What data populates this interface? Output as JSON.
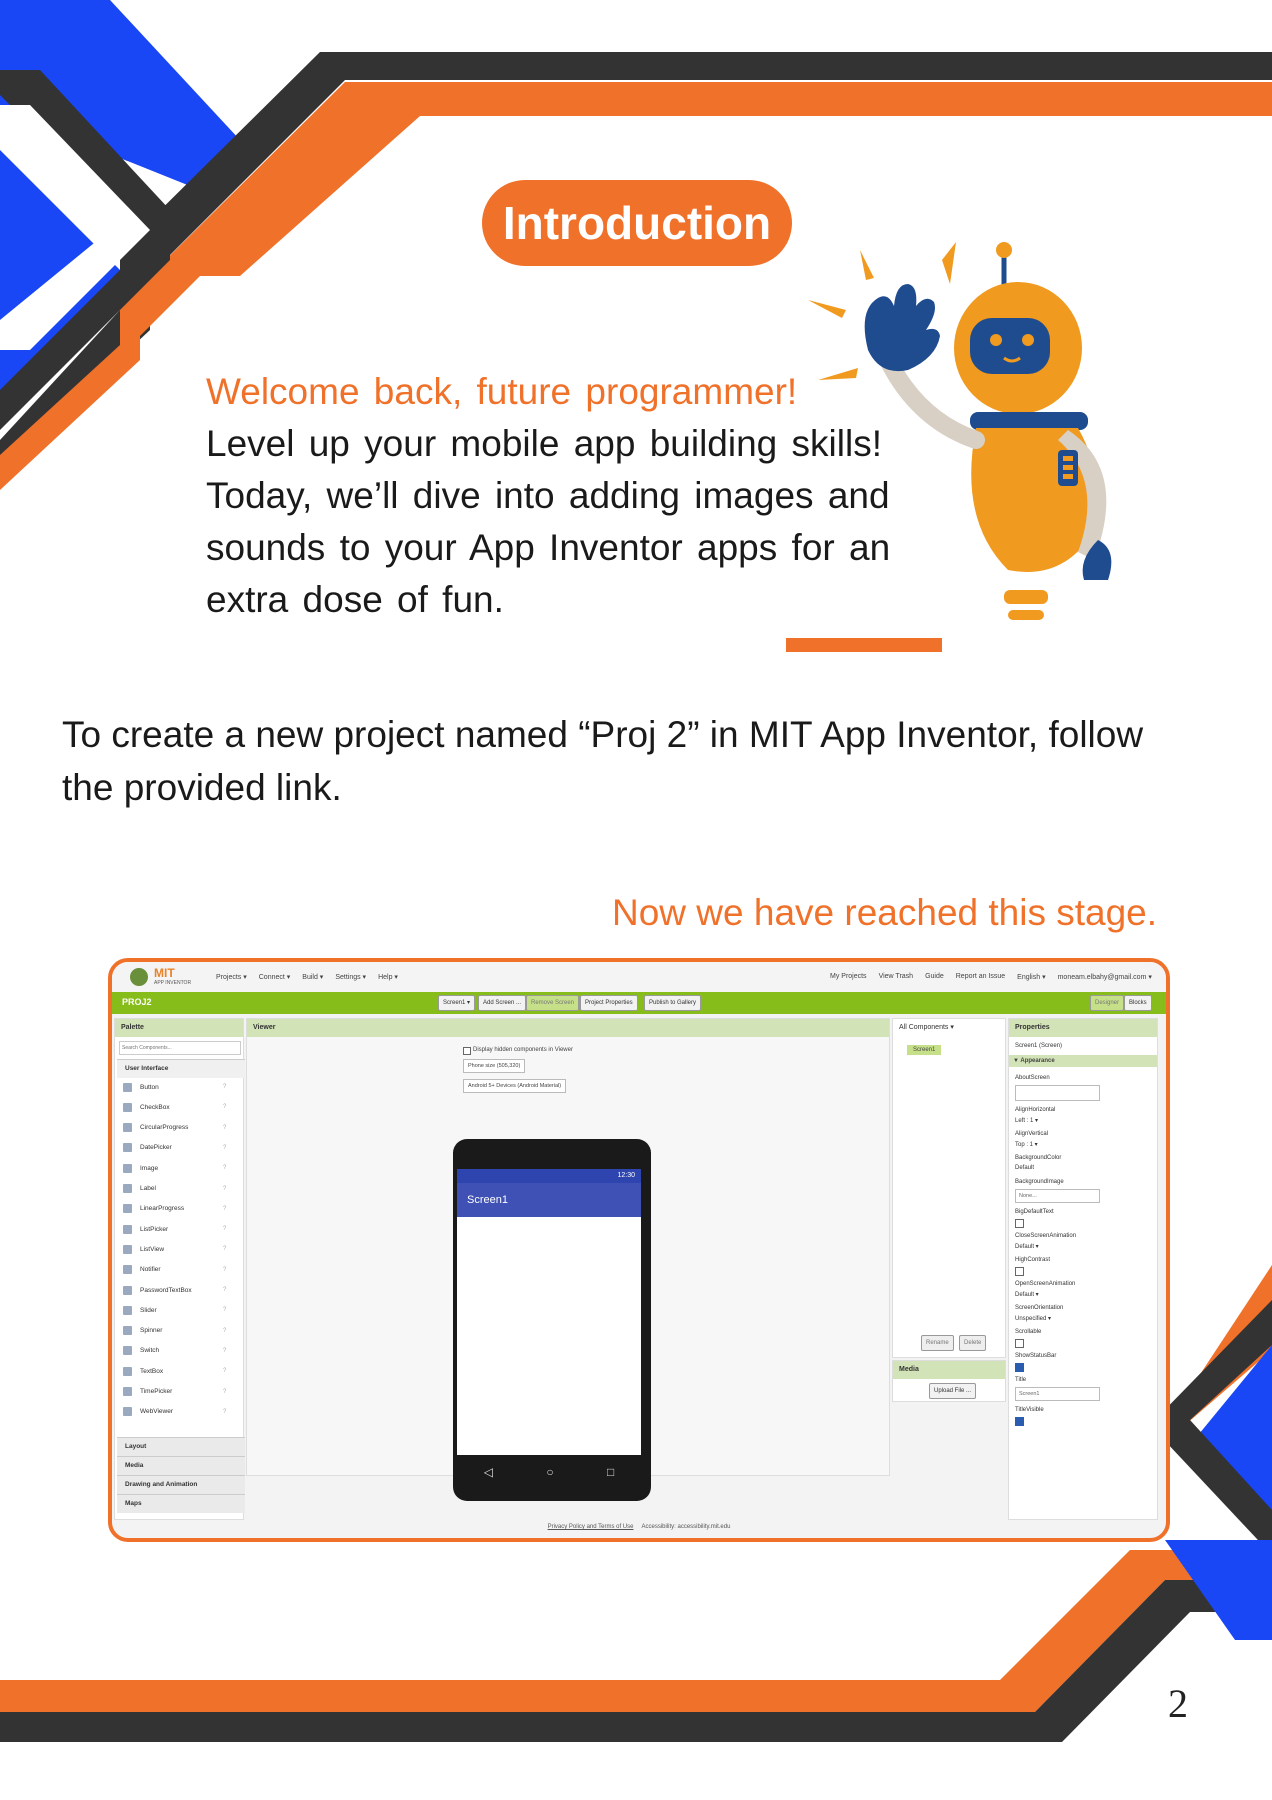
{
  "heading": "Introduction",
  "welcome": {
    "greeting": "Welcome back, future programmer!",
    "line2": "Level up your mobile app building skills!",
    "line3": "Today, we’ll dive into adding images and",
    "line4": "sounds to your App Inventor apps for an",
    "line5": "extra dose of fun."
  },
  "instruction": {
    "line1": "To create a new project named “Proj 2” in MIT App Inventor, follow",
    "line2": "the provided link."
  },
  "stage_note": "Now we have reached this stage.",
  "page_number": "2",
  "colors": {
    "accent": "#f0712a",
    "blue": "#1a47f5",
    "dark": "#333333",
    "app_green": "#86bd1a"
  },
  "app_inventor": {
    "logo": {
      "title": "MIT",
      "subtitle": "APP INVENTOR"
    },
    "menu": [
      "Projects ▾",
      "Connect ▾",
      "Build ▾",
      "Settings ▾",
      "Help ▾"
    ],
    "right_menu": [
      "My Projects",
      "View Trash",
      "Guide",
      "Report an Issue",
      "English ▾",
      "moneam.elbahy@gmail.com ▾"
    ],
    "project_name": "PROJ2",
    "toolbar": [
      "Screen1 ▾",
      "Add Screen ...",
      "Remove Screen",
      "Project Properties",
      "Publish to Gallery"
    ],
    "mode_buttons": [
      "Designer",
      "Blocks"
    ],
    "palette": {
      "title": "Palette",
      "search_placeholder": "Search Components...",
      "section": "User Interface",
      "items": [
        "Button",
        "CheckBox",
        "CircularProgress",
        "DatePicker",
        "Image",
        "Label",
        "LinearProgress",
        "ListPicker",
        "ListView",
        "Notifier",
        "PasswordTextBox",
        "Slider",
        "Spinner",
        "Switch",
        "TextBox",
        "TimePicker",
        "WebViewer"
      ],
      "categories": [
        "Layout",
        "Media",
        "Drawing and Animation",
        "Maps"
      ]
    },
    "viewer": {
      "title": "Viewer",
      "hidden_label": "Display hidden components in Viewer",
      "phone_size": "Phone size (505,320)",
      "device": "Android 5+ Devices (Android Material)",
      "status_time": "12:30",
      "screen_title": "Screen1"
    },
    "components": {
      "title": "All Components ▾",
      "tree_item": "Screen1",
      "rename": "Rename",
      "delete": "Delete",
      "media_title": "Media",
      "upload": "Upload File ..."
    },
    "properties": {
      "title": "Properties",
      "subtitle": "Screen1 (Screen)",
      "group": "▼ Appearance",
      "about": "AboutScreen",
      "align_h": "AlignHorizontal",
      "align_h_val": "Left : 1 ▾",
      "align_v": "AlignVertical",
      "align_v_val": "Top : 1 ▾",
      "bg_color": "BackgroundColor",
      "bg_color_val": "Default",
      "bg_image": "BackgroundImage",
      "bg_image_val": "None...",
      "big_text": "BigDefaultText",
      "close_anim": "CloseScreenAnimation",
      "close_anim_val": "Default ▾",
      "high_contrast": "HighContrast",
      "open_anim": "OpenScreenAnimation",
      "open_anim_val": "Default ▾",
      "orientation": "ScreenOrientation",
      "orientation_val": "Unspecified ▾",
      "scrollable": "Scrollable",
      "show_status": "ShowStatusBar",
      "title_prop": "Title",
      "title_val": "Screen1",
      "title_visible": "TitleVisible"
    },
    "footer": "Privacy Policy and Terms of Use",
    "footer2": "Accessibility: accessibility.mit.edu"
  }
}
